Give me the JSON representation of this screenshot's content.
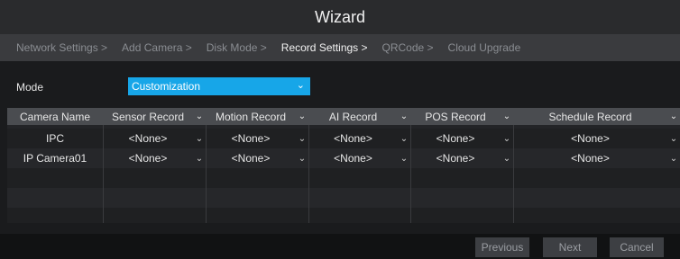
{
  "window": {
    "title": "Wizard"
  },
  "steps": [
    {
      "label": "Network Settings >",
      "active": false
    },
    {
      "label": "Add Camera >",
      "active": false
    },
    {
      "label": "Disk Mode >",
      "active": false
    },
    {
      "label": "Record Settings >",
      "active": true
    },
    {
      "label": "QRCode >",
      "active": false
    },
    {
      "label": "Cloud Upgrade",
      "active": false
    }
  ],
  "mode": {
    "label": "Mode",
    "value": "Customization"
  },
  "table": {
    "columns": [
      "Camera Name",
      "Sensor Record",
      "Motion Record",
      "AI Record",
      "POS Record",
      "Schedule Record"
    ],
    "rows": [
      {
        "camera": "IPC",
        "sensor": "<None>",
        "motion": "<None>",
        "ai": "<None>",
        "pos": "<None>",
        "schedule": "<None>"
      },
      {
        "camera": "IP Camera01",
        "sensor": "<None>",
        "motion": "<None>",
        "ai": "<None>",
        "pos": "<None>",
        "schedule": "<None>"
      }
    ]
  },
  "buttons": {
    "previous": "Previous",
    "next": "Next",
    "cancel": "Cancel"
  },
  "colors": {
    "accent": "#17a6e8",
    "header": "#4a4c50",
    "background": "#1a1b1d"
  }
}
